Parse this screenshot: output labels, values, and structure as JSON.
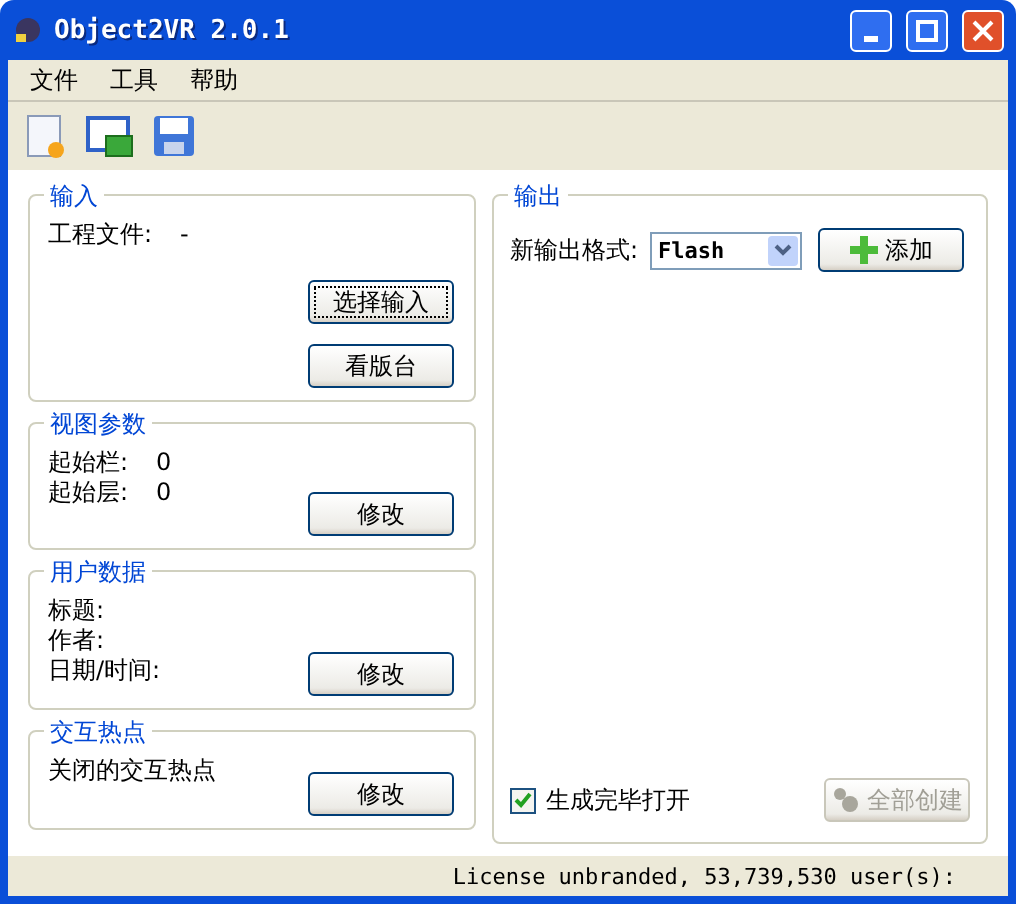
{
  "window": {
    "title": "Object2VR 2.0.1"
  },
  "menu": [
    "文件",
    "工具",
    "帮助"
  ],
  "toolbar": [
    {
      "kind": "new"
    },
    {
      "kind": "open"
    },
    {
      "kind": "save"
    }
  ],
  "groups": [
    {
      "title": "输入",
      "lines": [
        {
          "label": "工程文件:",
          "value": "-"
        }
      ],
      "buttons": [
        {
          "label": "选择输入",
          "focused": true
        },
        {
          "label": "看版台",
          "focused": false
        }
      ]
    },
    {
      "title": "视图参数",
      "lines": [
        {
          "label": "起始栏:",
          "value": "0"
        },
        {
          "label": "起始层:",
          "value": "0"
        }
      ],
      "buttons": [
        {
          "label": "修改",
          "focused": false
        }
      ]
    },
    {
      "title": "用户数据",
      "lines": [
        {
          "label": "标题:"
        },
        {
          "label": "作者:"
        },
        {
          "label": "日期/时间:"
        }
      ],
      "buttons": [
        {
          "label": "修改",
          "focused": false
        }
      ]
    },
    {
      "title": "交互热点",
      "lines": [
        {
          "label": "关闭的交互热点"
        }
      ],
      "buttons": [
        {
          "label": "修改",
          "focused": false
        }
      ]
    }
  ],
  "output": {
    "title": "输出",
    "format_label": "新输出格式:",
    "format_value": "Flash",
    "add_button": "添加",
    "open_checkbox": {
      "label": "生成完毕打开",
      "checked": true
    },
    "create_button": {
      "label": "全部创建",
      "disabled": true
    }
  },
  "status_bar": "License unbranded, 53,739,530 user(s):"
}
